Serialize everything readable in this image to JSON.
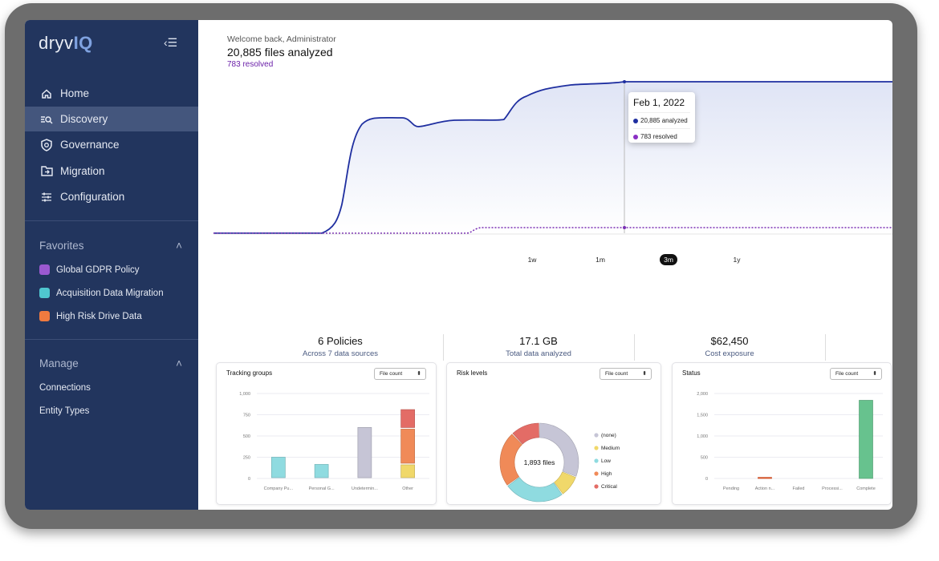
{
  "brand": {
    "logo_prefix": "dryv",
    "logo_suffix": "IQ"
  },
  "sidebar": {
    "nav": [
      {
        "label": "Home",
        "icon": "home-icon"
      },
      {
        "label": "Discovery",
        "icon": "discovery-search-icon",
        "active": true
      },
      {
        "label": "Governance",
        "icon": "shield-icon"
      },
      {
        "label": "Migration",
        "icon": "folder-arrow-icon"
      },
      {
        "label": "Configuration",
        "icon": "sliders-icon"
      }
    ],
    "favorites": {
      "title": "Favorites",
      "items": [
        {
          "label": "Global GDPR Policy",
          "color": "#9b59d0"
        },
        {
          "label": "Acquisition Data Migration",
          "color": "#4fc6cf"
        },
        {
          "label": "High Risk Drive Data",
          "color": "#ef7a3f"
        }
      ]
    },
    "manage": {
      "title": "Manage",
      "items": [
        {
          "label": "Connections"
        },
        {
          "label": "Entity Types"
        }
      ]
    }
  },
  "header": {
    "welcome": "Welcome back, Administrator",
    "headline": "20,885 files analyzed",
    "resolved": "783 resolved"
  },
  "tooltip": {
    "date": "Feb 1, 2022",
    "analyzed": "20,885 analyzed",
    "resolved": "783 resolved",
    "analyzed_color": "#1f2fa0",
    "resolved_color": "#8a2fc4"
  },
  "ranges": [
    "1w",
    "1m",
    "3m",
    "1y"
  ],
  "selected_range": "3m",
  "stats": [
    {
      "value": "6 Policies",
      "label": "Across 7 data sources"
    },
    {
      "value": "17.1 GB",
      "label": "Total data analyzed"
    },
    {
      "value": "$62,450",
      "label": "Cost exposure"
    }
  ],
  "cards": {
    "tracking": {
      "title": "Tracking groups",
      "select": "File count"
    },
    "risk": {
      "title": "Risk levels",
      "select": "File count",
      "center": "1,893 files"
    },
    "status": {
      "title": "Status",
      "select": "File count"
    }
  },
  "chart_data": [
    {
      "type": "bar",
      "title": "Tracking groups",
      "categories": [
        "Company Pu...",
        "Personal G...",
        "Undetermin...",
        "Other"
      ],
      "yticks": [
        "0",
        "250",
        "500",
        "750",
        "1,000"
      ],
      "ylim": [
        0,
        1000
      ],
      "series": [
        {
          "values": [
            260,
            175,
            610,
            170
          ],
          "colors": [
            "#8fdbe0",
            "#8fdbe0",
            "#c6c5d6",
            "#f0d86a"
          ]
        },
        {
          "values": [
            0,
            0,
            0,
            420
          ],
          "colors": [
            "",
            "",
            "",
            "#f08a58"
          ]
        },
        {
          "values": [
            0,
            0,
            0,
            230
          ],
          "colors": [
            "",
            "",
            "",
            "#e36c66"
          ]
        }
      ]
    },
    {
      "type": "pie",
      "title": "Risk levels",
      "labels": [
        "(none)",
        "Medium",
        "Low",
        "High",
        "Critical"
      ],
      "values": [
        31,
        9,
        25,
        23,
        12
      ],
      "colors": [
        "#c6c5d6",
        "#f0d86a",
        "#8fdbe0",
        "#f08a58",
        "#e36c66"
      ]
    },
    {
      "type": "bar",
      "title": "Status",
      "categories": [
        "Pending",
        "Action n...",
        "Failed",
        "Processi...",
        "Complete"
      ],
      "yticks": [
        "0",
        "500",
        "1,000",
        "1,500",
        "2,000"
      ],
      "ylim": [
        0,
        2000
      ],
      "values": [
        0,
        25,
        0,
        0,
        1840
      ],
      "colors": [
        "#ccc",
        "#ef5a2a",
        "#ccc",
        "#ccc",
        "#67c28e"
      ]
    }
  ]
}
